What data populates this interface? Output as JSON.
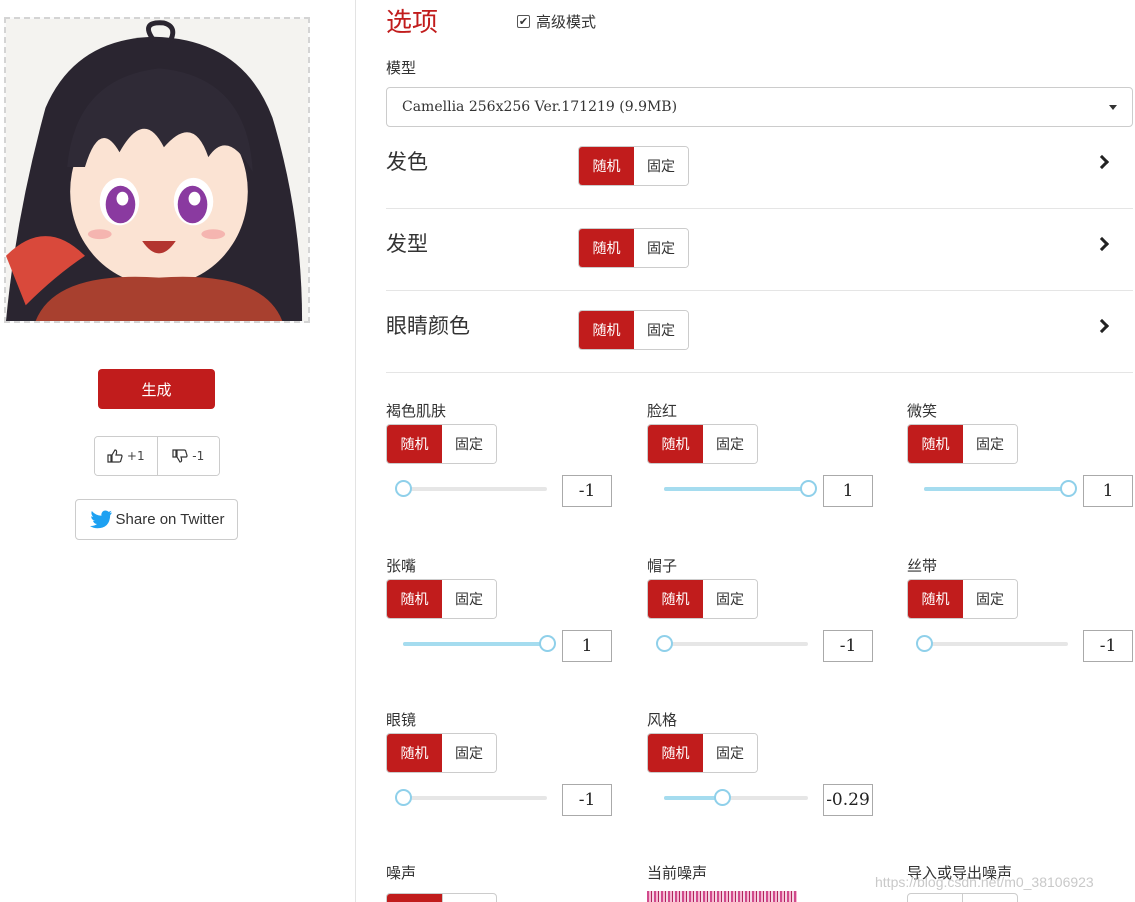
{
  "left": {
    "generate_label": "生成",
    "vote_up_label": "+1",
    "vote_down_label": "-1",
    "share_label": "Share on Twitter"
  },
  "options": {
    "title": "选项",
    "advanced_mode_label": "高级模式",
    "advanced_mode_checked": true,
    "model_label": "模型",
    "model_value": "Camellia 256x256 Ver.171219 (9.9MB)",
    "toggle_random": "随机",
    "toggle_fixed": "固定",
    "rows": [
      {
        "label": "发色"
      },
      {
        "label": "发型"
      },
      {
        "label": "眼睛颜色"
      }
    ],
    "features": [
      {
        "label": "褐色肌肤",
        "value": "-1",
        "level": 0
      },
      {
        "label": "脸红",
        "value": "1",
        "level": 1
      },
      {
        "label": "微笑",
        "value": "1",
        "level": 1
      },
      {
        "label": "张嘴",
        "value": "1",
        "level": 1
      },
      {
        "label": "帽子",
        "value": "-1",
        "level": 0
      },
      {
        "label": "丝带",
        "value": "-1",
        "level": 0
      },
      {
        "label": "眼镜",
        "value": "-1",
        "level": 0
      },
      {
        "label": "风格",
        "value": "-0.29",
        "level": 0.4
      }
    ],
    "noise_label": "噪声",
    "current_noise_label": "当前噪声",
    "import_export_label": "导入或导出噪声"
  },
  "colors": {
    "accent": "#c11c1c",
    "slider": "#a5dcef"
  },
  "watermark": "https://blog.csdn.net/m0_38106923"
}
